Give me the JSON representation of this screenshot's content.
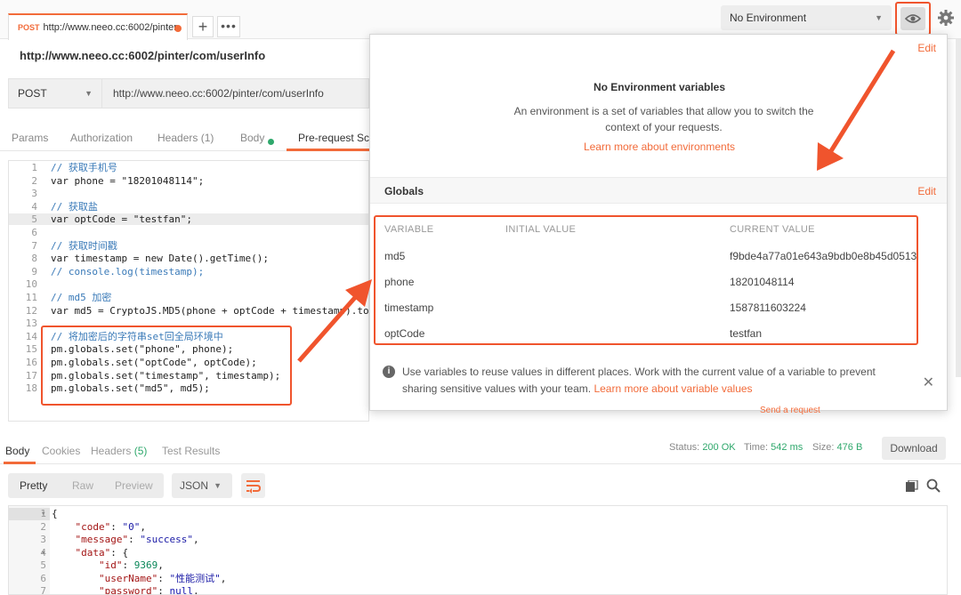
{
  "tab": {
    "method": "POST",
    "url": "http://www.neeo.cc:6002/pinter"
  },
  "environment": {
    "selected": "No Environment",
    "eye_icon": "eye-icon",
    "gear_icon": "gear-icon"
  },
  "request": {
    "title": "http://www.neeo.cc:6002/pinter/com/userInfo",
    "method": "POST",
    "url": "http://www.neeo.cc:6002/pinter/com/userInfo",
    "tabs": {
      "params": "Params",
      "authorization": "Authorization",
      "headers": "Headers",
      "headers_count": "(1)",
      "body": "Body",
      "prerequest": "Pre-request Scr"
    }
  },
  "script_lines": [
    {
      "n": "1",
      "text": "// 获取手机号",
      "kind": "com"
    },
    {
      "n": "2",
      "text": "var phone = \"18201048114\";",
      "kind": "code"
    },
    {
      "n": "3",
      "text": "",
      "kind": "code"
    },
    {
      "n": "4",
      "text": "// 获取盐",
      "kind": "com"
    },
    {
      "n": "5",
      "text": "var optCode = \"testfan\";",
      "kind": "code"
    },
    {
      "n": "6",
      "text": "",
      "kind": "code"
    },
    {
      "n": "7",
      "text": "// 获取时间戳",
      "kind": "com"
    },
    {
      "n": "8",
      "text": "var timestamp = new Date().getTime();",
      "kind": "code"
    },
    {
      "n": "9",
      "text": "// console.log(timestamp);",
      "kind": "com"
    },
    {
      "n": "10",
      "text": "",
      "kind": "code"
    },
    {
      "n": "11",
      "text": "// md5 加密",
      "kind": "com"
    },
    {
      "n": "12",
      "text": "var md5 = CryptoJS.MD5(phone + optCode + timestamp).to",
      "kind": "code"
    },
    {
      "n": "13",
      "text": "",
      "kind": "code"
    },
    {
      "n": "14",
      "text": "// 将加密后的字符串set回全局环境中",
      "kind": "com"
    },
    {
      "n": "15",
      "text": "pm.globals.set(\"phone\", phone);",
      "kind": "code"
    },
    {
      "n": "16",
      "text": "pm.globals.set(\"optCode\", optCode);",
      "kind": "code"
    },
    {
      "n": "17",
      "text": "pm.globals.set(\"timestamp\", timestamp);",
      "kind": "code"
    },
    {
      "n": "18",
      "text": "pm.globals.set(\"md5\", md5);",
      "kind": "code"
    }
  ],
  "popover": {
    "edit_top": "Edit",
    "title": "No Environment variables",
    "description": "An environment is a set of variables that allow you to switch the context of your requests.",
    "learn_more": "Learn more about environments",
    "globals_title": "Globals",
    "globals_edit": "Edit",
    "columns": {
      "variable": "VARIABLE",
      "initial": "INITIAL VALUE",
      "current": "CURRENT VALUE"
    },
    "rows": [
      {
        "variable": "md5",
        "initial": "",
        "current": "f9bde4a77a01e643a9bdb0e8b45d0513"
      },
      {
        "variable": "phone",
        "initial": "",
        "current": "18201048114"
      },
      {
        "variable": "timestamp",
        "initial": "",
        "current": "1587811603224"
      },
      {
        "variable": "optCode",
        "initial": "",
        "current": "testfan"
      }
    ],
    "info_text": "Use variables to reuse values in different places. Work with the current value of a variable to prevent sharing sensitive values with your team.",
    "info_link": "Learn more about variable values",
    "close": "✕"
  },
  "send_request_link": "Send a request",
  "response": {
    "tabs": {
      "body": "Body",
      "cookies": "Cookies",
      "headers": "Headers",
      "headers_count": "(5)",
      "test_results": "Test Results"
    },
    "status_label": "Status:",
    "status_value": "200 OK",
    "time_label": "Time:",
    "time_value": "542 ms",
    "size_label": "Size:",
    "size_value": "476 B",
    "download": "Download",
    "formats": {
      "pretty": "Pretty",
      "raw": "Raw",
      "preview": "Preview"
    },
    "language": "JSON",
    "lines": [
      {
        "n": "1",
        "fold": "▾",
        "indent": "",
        "key": "",
        "value": "",
        "punc": "{"
      },
      {
        "n": "2",
        "fold": "",
        "indent": "    ",
        "key": "\"code\"",
        "value": "\"0\"",
        "punc": ","
      },
      {
        "n": "3",
        "fold": "",
        "indent": "    ",
        "key": "\"message\"",
        "value": "\"success\"",
        "punc": ","
      },
      {
        "n": "4",
        "fold": "▾",
        "indent": "    ",
        "key": "\"data\"",
        "value": "",
        "punc": "{"
      },
      {
        "n": "5",
        "fold": "",
        "indent": "        ",
        "key": "\"id\"",
        "value": "9369",
        "punc": ","
      },
      {
        "n": "6",
        "fold": "",
        "indent": "        ",
        "key": "\"userName\"",
        "value": "\"性能测试\"",
        "punc": ","
      },
      {
        "n": "7",
        "fold": "",
        "indent": "        ",
        "key": "\"password\"",
        "value": "null",
        "punc": ","
      }
    ]
  },
  "accent": "#f26b3a",
  "annotation_color": "#f0542d",
  "success_color": "#2fa86c"
}
